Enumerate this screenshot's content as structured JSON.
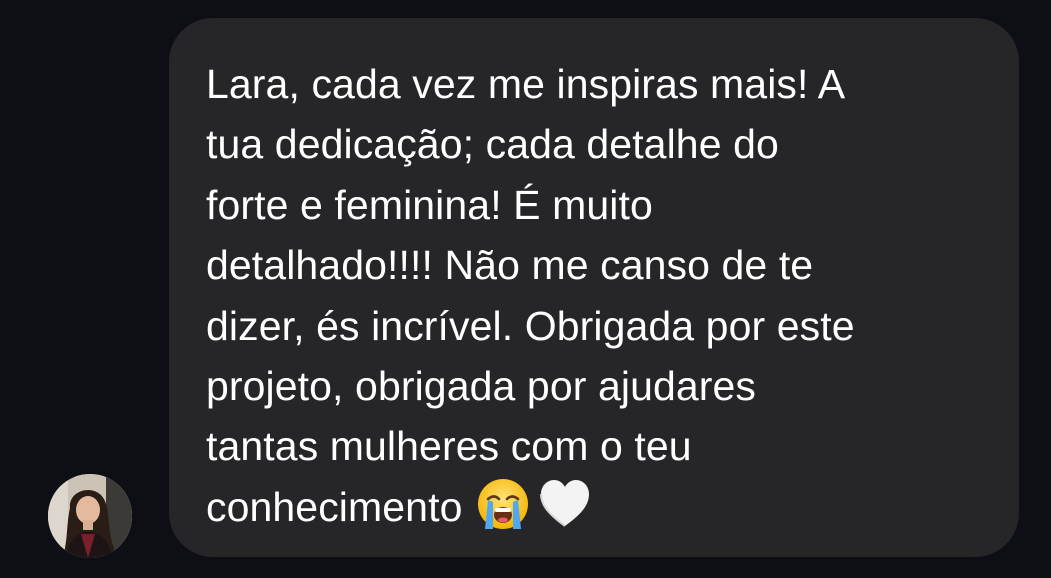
{
  "message": {
    "lines": [
      "Lara, cada vez me inspiras mais! A",
      "tua dedicação; cada detalhe do",
      "forte e feminina! É muito",
      "detalhado!!!! Não me canso de te",
      "dizer, és incrível. Obrigada por este",
      "projeto, obrigada por ajudares",
      "tantas mulheres com o teu",
      "conhecimento"
    ],
    "emojis": [
      "loudly-crying-face-emoji",
      "white-heart-emoji"
    ]
  },
  "colors": {
    "background": "#0e0f14",
    "bubble": "#262629",
    "text": "#ffffff"
  }
}
